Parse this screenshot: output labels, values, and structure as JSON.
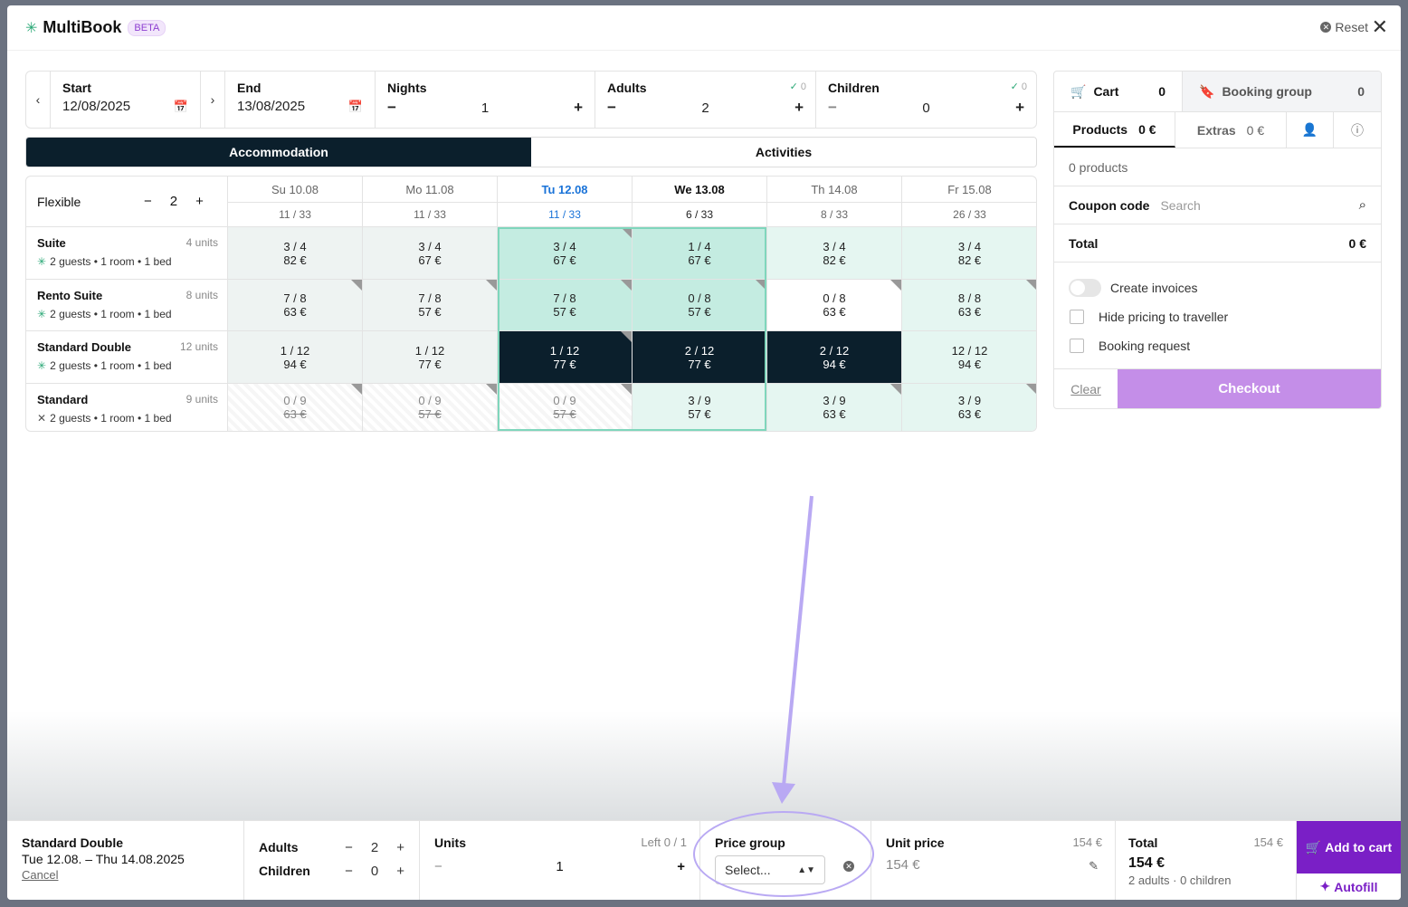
{
  "header": {
    "brand": "MultiBook",
    "badge": "BETA",
    "reset": "Reset"
  },
  "search": {
    "start_label": "Start",
    "start_value": "12/08/2025",
    "end_label": "End",
    "end_value": "13/08/2025",
    "nights_label": "Nights",
    "nights_value": "1",
    "adults_label": "Adults",
    "adults_value": "2",
    "adults_check": "0",
    "children_label": "Children",
    "children_value": "0",
    "children_check": "0"
  },
  "tabs": {
    "accommodation": "Accommodation",
    "activities": "Activities"
  },
  "grid": {
    "flexible_label": "Flexible",
    "flexible_value": "2",
    "days": [
      {
        "day": "Su 10.08",
        "occ": "11 / 33"
      },
      {
        "day": "Mo 11.08",
        "occ": "11 / 33"
      },
      {
        "day": "Tu 12.08",
        "occ": "11 / 33"
      },
      {
        "day": "We 13.08",
        "occ": "6 / 33"
      },
      {
        "day": "Th 14.08",
        "occ": "8 / 33"
      },
      {
        "day": "Fr 15.08",
        "occ": "26 / 33"
      }
    ],
    "rows": [
      {
        "name": "Suite",
        "units": "4 units",
        "sub": "2 guests • 1 room • 1 bed",
        "cells": [
          {
            "a": "3 / 4",
            "p": "82 €"
          },
          {
            "a": "3 / 4",
            "p": "67 €"
          },
          {
            "a": "3 / 4",
            "p": "67 €"
          },
          {
            "a": "1 / 4",
            "p": "67 €"
          },
          {
            "a": "3 / 4",
            "p": "82 €"
          },
          {
            "a": "3 / 4",
            "p": "82 €"
          }
        ]
      },
      {
        "name": "Rento Suite",
        "units": "8 units",
        "sub": "2 guests • 1 room • 1 bed",
        "cells": [
          {
            "a": "7 / 8",
            "p": "63 €"
          },
          {
            "a": "7 / 8",
            "p": "57 €"
          },
          {
            "a": "7 / 8",
            "p": "57 €"
          },
          {
            "a": "0 / 8",
            "p": "57 €"
          },
          {
            "a": "0 / 8",
            "p": "63 €"
          },
          {
            "a": "8 / 8",
            "p": "63 €"
          }
        ]
      },
      {
        "name": "Standard Double",
        "units": "12 units",
        "sub": "2 guests • 1 room • 1 bed",
        "cells": [
          {
            "a": "1 / 12",
            "p": "94 €"
          },
          {
            "a": "1 / 12",
            "p": "77 €"
          },
          {
            "a": "1 / 12",
            "p": "77 €"
          },
          {
            "a": "2 / 12",
            "p": "77 €"
          },
          {
            "a": "2 / 12",
            "p": "94 €"
          },
          {
            "a": "12 / 12",
            "p": "94 €"
          }
        ]
      },
      {
        "name": "Standard",
        "units": "9 units",
        "sub": "2 guests • 1 room • 1 bed",
        "cells": [
          {
            "a": "0 / 9",
            "p": "63 €"
          },
          {
            "a": "0 / 9",
            "p": "57 €"
          },
          {
            "a": "0 / 9",
            "p": "57 €"
          },
          {
            "a": "3 / 9",
            "p": "57 €"
          },
          {
            "a": "3 / 9",
            "p": "63 €"
          },
          {
            "a": "3 / 9",
            "p": "63 €"
          }
        ]
      }
    ]
  },
  "cart": {
    "cart_label": "Cart",
    "cart_count": "0",
    "group_label": "Booking group",
    "group_count": "0",
    "products_label": "Products",
    "products_value": "0 €",
    "extras_label": "Extras",
    "extras_value": "0 €",
    "empty": "0 products",
    "coupon_label": "Coupon code",
    "coupon_placeholder": "Search",
    "total_label": "Total",
    "total_value": "0 €",
    "create_invoices": "Create invoices",
    "hide_pricing": "Hide pricing to traveller",
    "booking_request": "Booking request",
    "clear": "Clear",
    "checkout": "Checkout"
  },
  "bottom": {
    "room": "Standard Double",
    "dates": "Tue 12.08. – Thu 14.08.2025",
    "cancel": "Cancel",
    "adults_label": "Adults",
    "adults_value": "2",
    "children_label": "Children",
    "children_value": "0",
    "units_label": "Units",
    "units_left": "Left 0 / 1",
    "units_value": "1",
    "price_group_label": "Price group",
    "price_group_value": "Select...",
    "unit_price_label": "Unit price",
    "unit_price_top": "154 €",
    "unit_price_value": "154 €",
    "total_label": "Total",
    "total_top": "154 €",
    "total_value": "154 €",
    "total_sub": "2 adults · 0 children",
    "add_to_cart": "Add to cart",
    "autofill": "Autofill"
  }
}
